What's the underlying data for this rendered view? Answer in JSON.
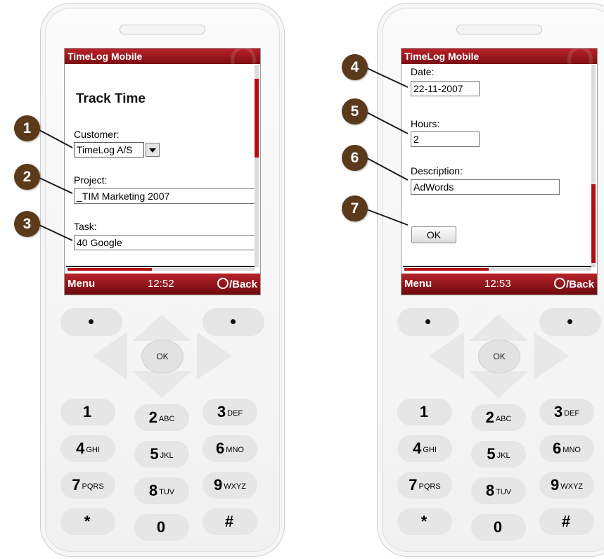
{
  "left_phone": {
    "app_title": "TimeLog Mobile",
    "heading": "Track Time",
    "customer": {
      "label": "Customer:",
      "value": "TimeLog A/S"
    },
    "project": {
      "label": "Project:",
      "value": "_TIM Marketing 2007"
    },
    "task": {
      "label": "Task:",
      "value": "40 Google"
    },
    "softbar": {
      "left": "Menu",
      "time": "12:52",
      "right": "/Back"
    }
  },
  "right_phone": {
    "app_title": "TimeLog Mobile",
    "date": {
      "label": "Date:",
      "value": "22-11-2007"
    },
    "hours": {
      "label": "Hours:",
      "value": "2"
    },
    "description": {
      "label": "Description:",
      "value": "AdWords"
    },
    "ok_button": "OK",
    "softbar": {
      "left": "Menu",
      "time": "12:53",
      "right": "/Back"
    }
  },
  "keypad": {
    "ok": "OK",
    "keys": [
      {
        "d": "1",
        "l": ""
      },
      {
        "d": "2",
        "l": "ABC"
      },
      {
        "d": "3",
        "l": "DEF"
      },
      {
        "d": "4",
        "l": "GHI"
      },
      {
        "d": "5",
        "l": "JKL"
      },
      {
        "d": "6",
        "l": "MNO"
      },
      {
        "d": "7",
        "l": "PQRS"
      },
      {
        "d": "8",
        "l": "TUV"
      },
      {
        "d": "9",
        "l": "WXYZ"
      },
      {
        "d": "*",
        "l": ""
      },
      {
        "d": "0",
        "l": ""
      },
      {
        "d": "#",
        "l": ""
      }
    ]
  },
  "callouts": [
    "1",
    "2",
    "3",
    "4",
    "5",
    "6",
    "7"
  ],
  "colors": {
    "brand_red": "#b30d12",
    "callout_brown": "#5b3a1c"
  },
  "icons": {
    "softbar_right": "magnifier-icon"
  }
}
